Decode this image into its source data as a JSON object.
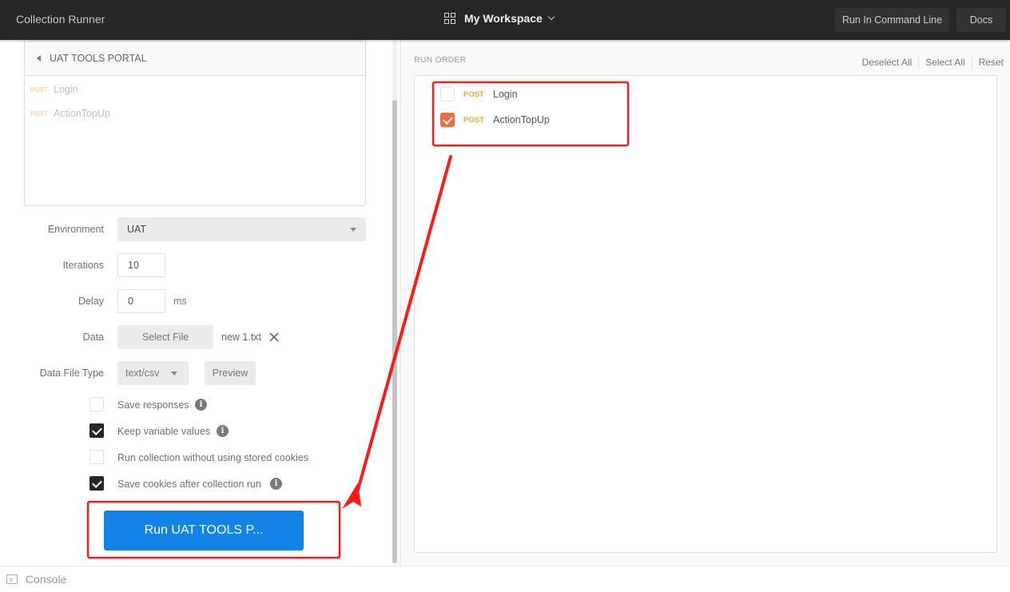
{
  "header": {
    "title": "Collection Runner",
    "workspace": "My Workspace",
    "run_cli_label": "Run In Command Line",
    "docs_label": "Docs"
  },
  "collection": {
    "name": "UAT TOOLS PORTAL",
    "requests": [
      {
        "method": "POST",
        "name": "Login"
      },
      {
        "method": "POST",
        "name": "ActionTopUp"
      }
    ]
  },
  "form": {
    "environment_label": "Environment",
    "environment_value": "UAT",
    "iterations_label": "Iterations",
    "iterations_value": "10",
    "delay_label": "Delay",
    "delay_value": "0",
    "delay_unit": "ms",
    "data_label": "Data",
    "select_file_label": "Select File",
    "file_name": "new 1.txt",
    "data_file_type_label": "Data File Type",
    "data_file_type_value": "text/csv",
    "preview_label": "Preview"
  },
  "options": [
    {
      "label": "Save responses",
      "checked": false,
      "info": true
    },
    {
      "label": "Keep variable values",
      "checked": true,
      "info": true
    },
    {
      "label": "Run collection without using stored cookies",
      "checked": false,
      "info": false
    },
    {
      "label": "Save cookies after collection run",
      "checked": true,
      "info": true
    }
  ],
  "run_button_label": "Run UAT TOOLS P...",
  "run_order": {
    "title": "RUN ORDER",
    "deselect_all": "Deselect All",
    "select_all": "Select All",
    "reset": "Reset",
    "items": [
      {
        "method": "POST",
        "name": "Login",
        "checked": false
      },
      {
        "method": "POST",
        "name": "ActionTopUp",
        "checked": true
      }
    ]
  },
  "console_label": "Console",
  "colors": {
    "topbar": "#262626",
    "run_button": "#1383e8",
    "checkbox_accent": "#f26b3a",
    "method_post": "#f5a623",
    "annotation": "#ff1a1a"
  }
}
